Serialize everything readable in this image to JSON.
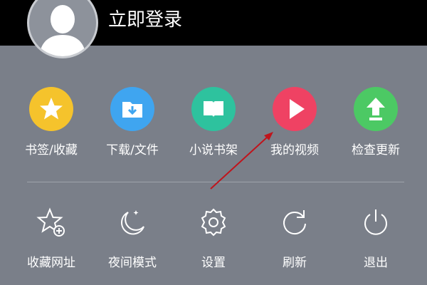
{
  "header": {
    "login_label": "立即登录"
  },
  "quick_items": [
    {
      "label": "书签/收藏",
      "color": "#f5c32c",
      "icon": "star-icon"
    },
    {
      "label": "下载/文件",
      "color": "#3fa5f0",
      "icon": "download-folder-icon"
    },
    {
      "label": "小说书架",
      "color": "#2ec29e",
      "icon": "book-icon"
    },
    {
      "label": "我的视频",
      "color": "#ef4263",
      "icon": "play-icon"
    },
    {
      "label": "检查更新",
      "color": "#4cc964",
      "icon": "upload-arrow-icon"
    }
  ],
  "settings_items": [
    {
      "label": "收藏网址",
      "icon": "star-plus-icon"
    },
    {
      "label": "夜间模式",
      "icon": "moon-icon"
    },
    {
      "label": "设置",
      "icon": "gear-icon"
    },
    {
      "label": "刷新",
      "icon": "refresh-icon"
    },
    {
      "label": "退出",
      "icon": "power-icon"
    }
  ],
  "colors": {
    "background": "#7a7f89",
    "header": "#000000",
    "annotation_arrow": "#c0141c"
  }
}
